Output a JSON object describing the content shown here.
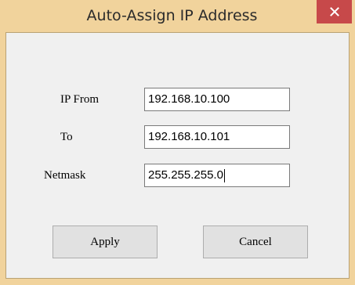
{
  "window": {
    "title": "Auto-Assign IP Address",
    "close_icon": "close-icon"
  },
  "form": {
    "ip_from": {
      "label": "IP From",
      "value": "192.168.10.100"
    },
    "to": {
      "label": "To",
      "value": "192.168.10.101"
    },
    "netmask": {
      "label": "Netmask",
      "value": "255.255.255.0"
    }
  },
  "buttons": {
    "apply_label": "Apply",
    "cancel_label": "Cancel"
  },
  "colors": {
    "title_bar": "#f1d39c",
    "close_button": "#c7494a",
    "client_background": "#f0f0f0"
  }
}
